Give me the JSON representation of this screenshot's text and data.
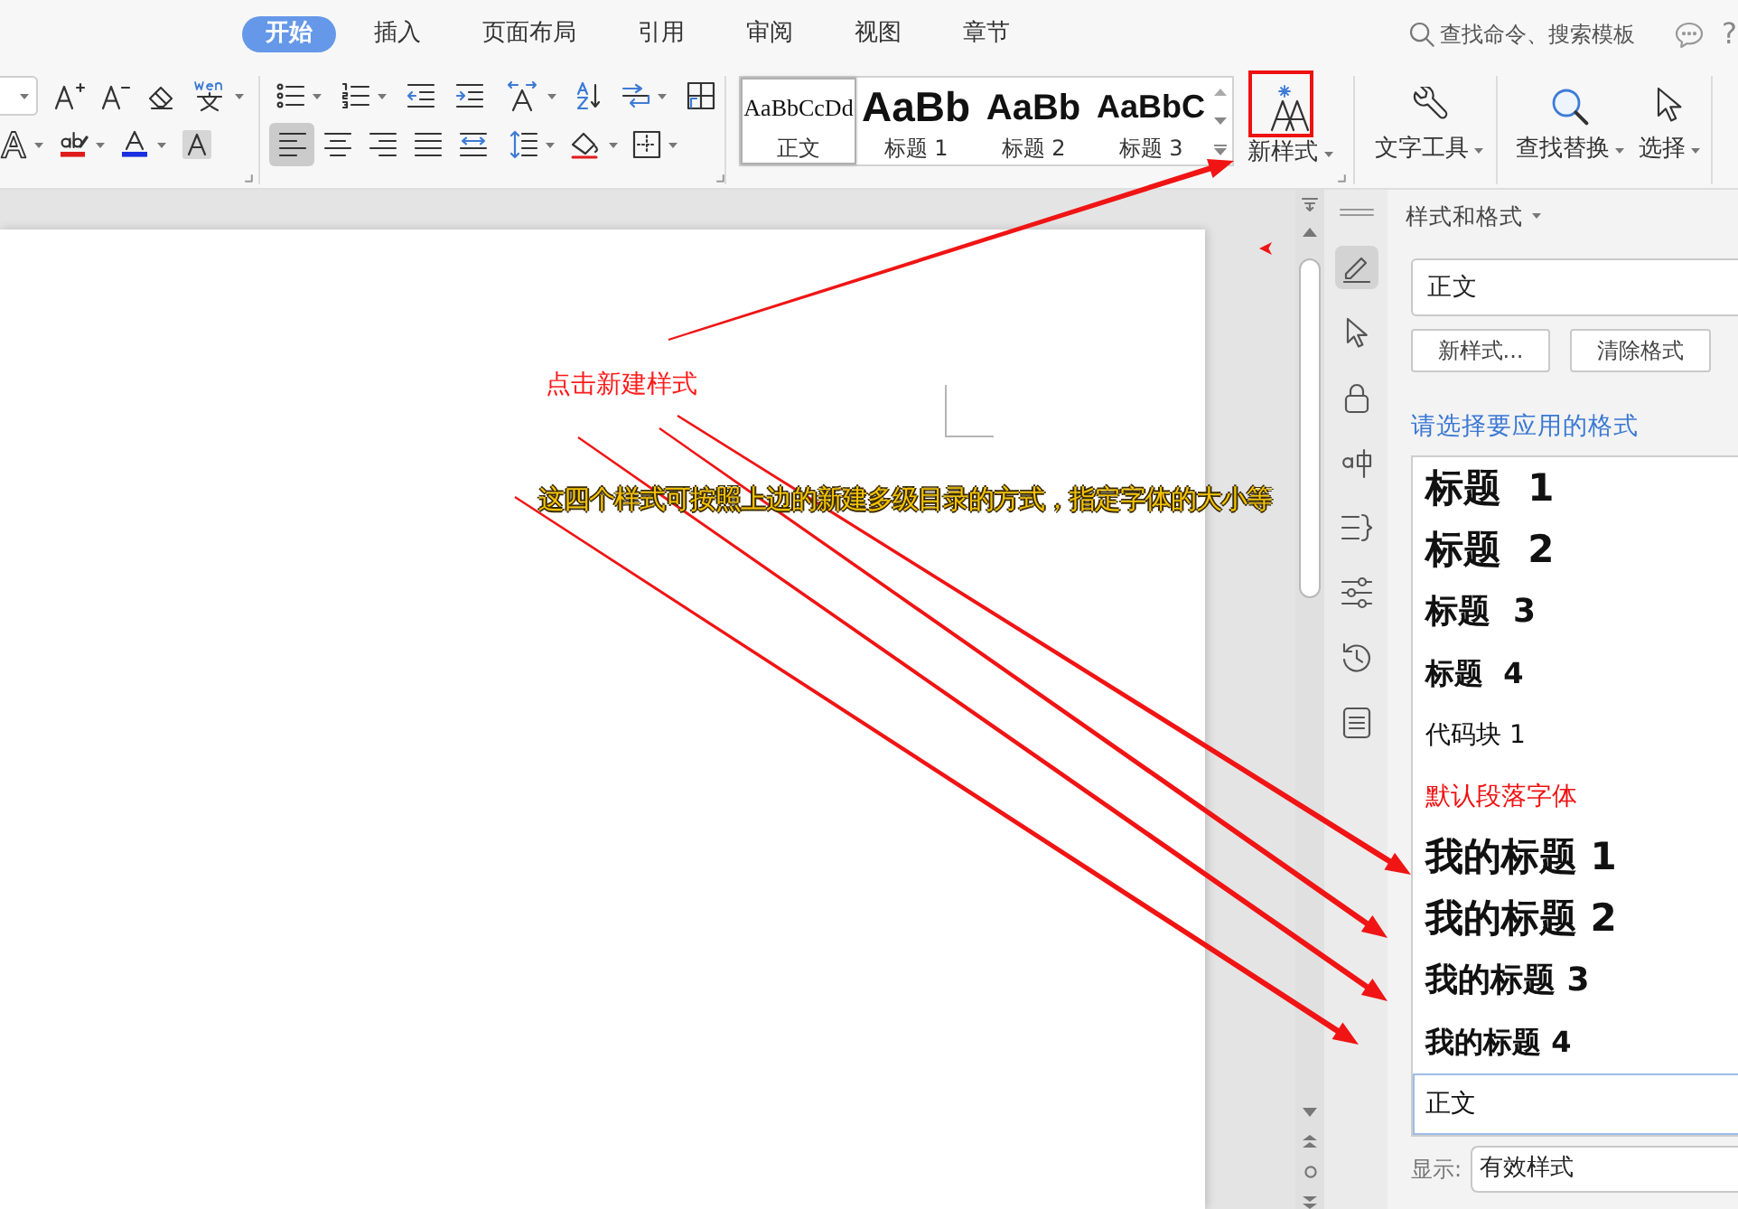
{
  "ribbon_tabs": [
    {
      "label": "开始",
      "selected": true
    },
    {
      "label": "插入",
      "selected": false
    },
    {
      "label": "页面布局",
      "selected": false
    },
    {
      "label": "引用",
      "selected": false
    },
    {
      "label": "审阅",
      "selected": false
    },
    {
      "label": "视图",
      "selected": false
    },
    {
      "label": "章节",
      "selected": false
    }
  ],
  "search": {
    "placeholder": "查找命令、搜索模板"
  },
  "help": "?",
  "paragraph": {
    "alignment": [
      {
        "selected": true
      },
      {
        "selected": false
      },
      {
        "selected": false
      },
      {
        "selected": false
      },
      {
        "selected": false
      }
    ]
  },
  "style_gallery": [
    {
      "kind": "body",
      "sample": "AaBbCcDd",
      "label": "正文",
      "selected": true
    },
    {
      "kind": "h1",
      "sample": "AaBb",
      "label": "标题 1",
      "selected": false
    },
    {
      "kind": "h2",
      "sample": "AaBb",
      "label": "标题 2",
      "selected": false
    },
    {
      "kind": "h3",
      "sample": "AaBbC",
      "label": "标题 3",
      "selected": false
    }
  ],
  "ribbon_buttons": [
    {
      "kind": "newstyle",
      "label": "新样式"
    },
    {
      "kind": "texttools",
      "label": "文字工具"
    },
    {
      "kind": "find",
      "label": "查找替换"
    },
    {
      "kind": "select",
      "label": "选择"
    }
  ],
  "side_tools": [
    {
      "kind": "style",
      "selected": true
    },
    {
      "kind": "pointer",
      "selected": false
    },
    {
      "kind": "lock",
      "selected": false
    },
    {
      "kind": "translate",
      "selected": false
    },
    {
      "kind": "outline",
      "selected": false
    },
    {
      "kind": "settings",
      "selected": false
    },
    {
      "kind": "history",
      "selected": false
    },
    {
      "kind": "backup",
      "selected": false
    }
  ],
  "styles_panel": {
    "title": "样式和格式",
    "current_style": "正文",
    "buttons": [
      "新样式...",
      "清除格式"
    ],
    "prompt": "请选择要应用的格式",
    "styles": [
      {
        "label": "标题  1",
        "kind": "h1",
        "selected": false
      },
      {
        "label": "标题  2",
        "kind": "h2",
        "selected": false
      },
      {
        "label": "标题  3",
        "kind": "h3",
        "selected": false
      },
      {
        "label": "标题  4",
        "kind": "h4",
        "selected": false
      },
      {
        "label": "代码块 1",
        "kind": "plain",
        "selected": false
      },
      {
        "label": "默认段落字体",
        "kind": "character",
        "selected": false
      },
      {
        "label": "我的标题 1",
        "kind": "h1",
        "selected": false
      },
      {
        "label": "我的标题 2",
        "kind": "h2",
        "selected": false
      },
      {
        "label": "我的标题 3",
        "kind": "h3",
        "selected": false
      },
      {
        "label": "我的标题 4",
        "kind": "h4",
        "selected": false
      },
      {
        "label": "正文",
        "kind": "body",
        "selected": true
      }
    ],
    "show_label": "显示:",
    "show_value": "有效样式"
  },
  "annotations": [
    {
      "kind": "callout",
      "text": "点击新建样式"
    },
    {
      "kind": "caption",
      "text": "这四个样式可按照上边的新建多级目录的方式，指定字体的大小等"
    }
  ]
}
